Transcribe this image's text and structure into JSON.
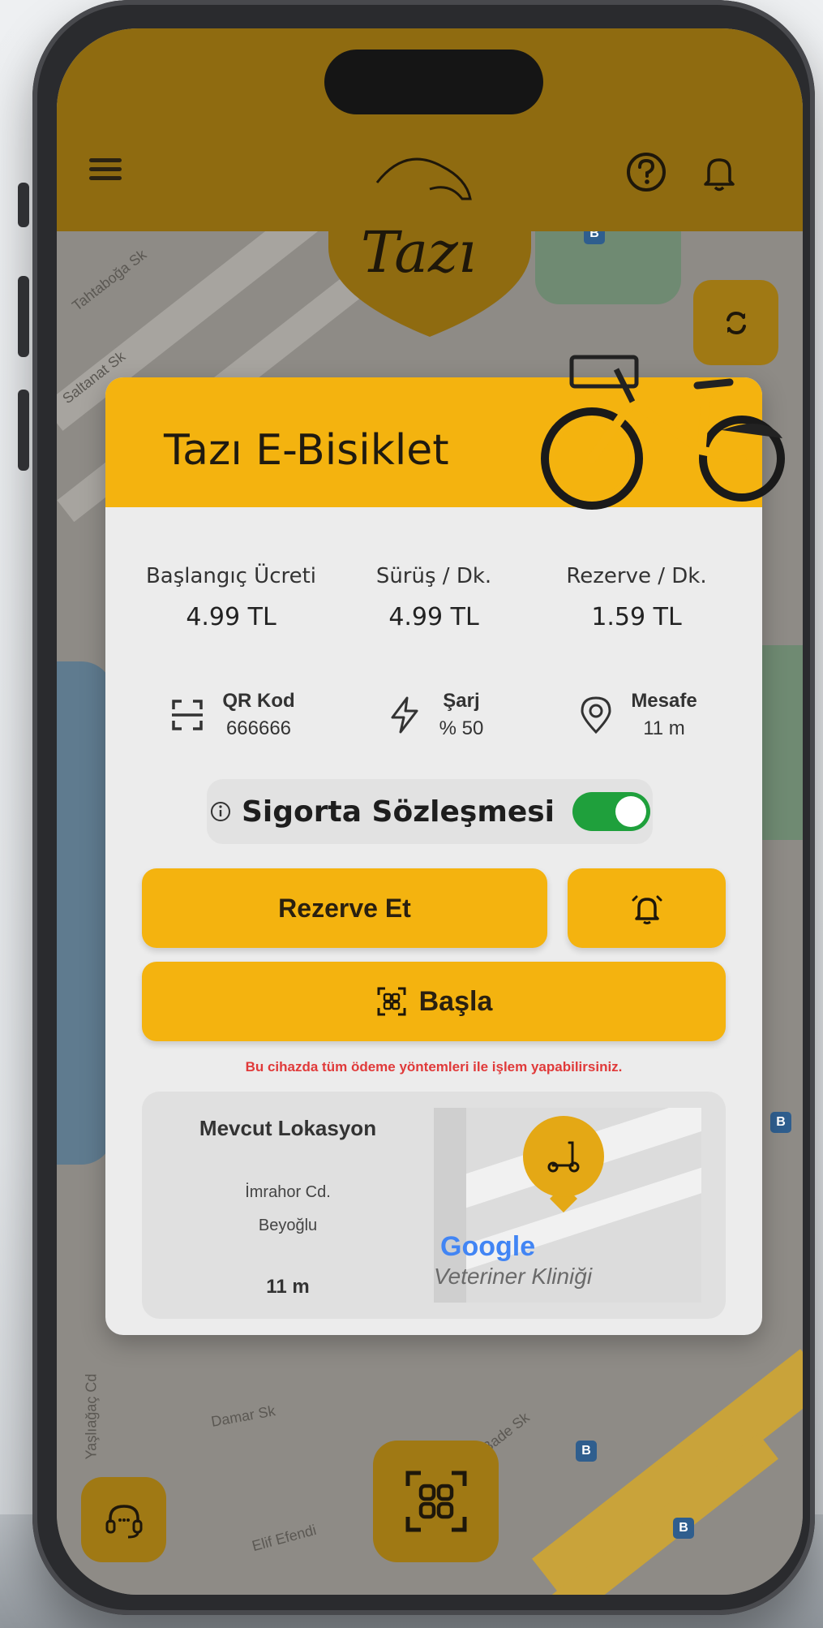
{
  "app": {
    "brand": "Tazı",
    "accent_color": "#f4b30f",
    "toggle_color": "#1fa03c",
    "alert_color": "#e03a3a"
  },
  "header": {
    "menu_icon": "hamburger-menu-icon",
    "help_icon": "question-circle-icon",
    "notification_icon": "bell-icon",
    "logo_text": "Tazı"
  },
  "map": {
    "streets": [
      "Tahtaboğa Sk",
      "Saltanat Sk",
      "Damar Sk",
      "Bade Sk",
      "Elif Efendi",
      "Yaşlıağaç Cd"
    ]
  },
  "card": {
    "title": "Tazı E-Bisiklet",
    "prices": [
      {
        "label": "Başlangıç Ücreti",
        "value": "4.99 TL"
      },
      {
        "label": "Sürüş / Dk.",
        "value": "4.99 TL"
      },
      {
        "label": "Rezerve / Dk.",
        "value": "1.59 TL"
      }
    ],
    "stats": {
      "qr": {
        "label": "QR Kod",
        "value": "666666",
        "icon": "qr-scan-icon"
      },
      "charge": {
        "label": "Şarj",
        "value": "% 50",
        "icon": "lightning-icon"
      },
      "distance": {
        "label": "Mesafe",
        "value": "11 m",
        "icon": "location-pin-icon"
      }
    },
    "insurance": {
      "label": "Sigorta Sözleşmesi",
      "enabled": true
    },
    "buttons": {
      "reserve": "Rezerve Et",
      "alarm_icon": "alarm-bell-icon",
      "start": "Başla"
    },
    "payment_note": "Bu cihazda tüm ödeme yöntemleri ile işlem yapabilirsiniz.",
    "location": {
      "title": "Mevcut Lokasyon",
      "street": "İmrahor Cd.",
      "district": "Beyoğlu",
      "distance": "11 m",
      "map_brand": "Google",
      "map_place": "Veteriner Kliniği"
    }
  }
}
